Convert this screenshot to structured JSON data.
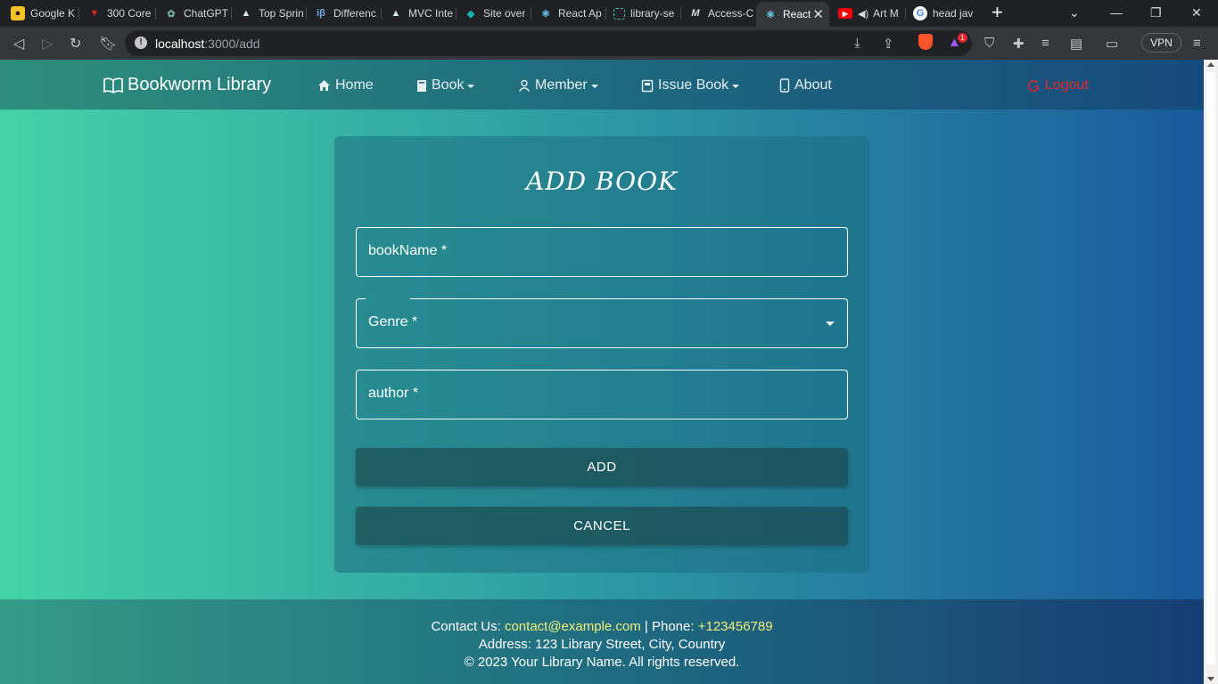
{
  "browser": {
    "tabs": [
      {
        "label": "Google K",
        "icon": "google-keep-icon",
        "color": "#f6c026"
      },
      {
        "label": "300 Core",
        "icon": "v-brand-icon",
        "color": "#d0251c"
      },
      {
        "label": "ChatGPT",
        "icon": "chatgpt-icon",
        "color": "#74aa9c"
      },
      {
        "label": "Top Sprin",
        "icon": "mountain-icon",
        "color": "#cfe6f5"
      },
      {
        "label": "Differenc",
        "icon": "ib-icon",
        "color": "#6fa8dc"
      },
      {
        "label": "MVC Inte",
        "icon": "mountain-icon",
        "color": "#cfe6f5"
      },
      {
        "label": "Site over",
        "icon": "diamond-icon",
        "color": "#13b5b1"
      },
      {
        "label": "React Ap",
        "icon": "react-icon",
        "color": "#61dafb"
      },
      {
        "label": "library-se",
        "icon": "code-icon",
        "color": "#3cc7c7"
      },
      {
        "label": "Access-C",
        "icon": "m-icon",
        "color": "#dddddd"
      },
      {
        "label": "React",
        "icon": "react-icon",
        "color": "#61dafb",
        "active": true
      },
      {
        "label": "Art M",
        "icon": "youtube-icon",
        "color": "#ff0000"
      },
      {
        "label": "head jav",
        "icon": "google-icon",
        "color": "#4285f4"
      }
    ],
    "url_host": "localhost",
    "url_path": ":3000/add",
    "vpn_label": "VPN",
    "notification_count": "1"
  },
  "navbar": {
    "brand": "Bookworm Library",
    "home": "Home",
    "book": "Book",
    "member": "Member",
    "issue_book": "Issue Book",
    "about": "About",
    "logout": "Logout"
  },
  "form": {
    "title": "ADD BOOK",
    "book_name_label": "bookName *",
    "genre_label": "Genre *",
    "author_label": "author *",
    "add_button": "ADD",
    "cancel_button": "CANCEL"
  },
  "footer": {
    "contact_prefix": "Contact Us: ",
    "email": "contact@example.com",
    "phone_sep": " | Phone: ",
    "phone": "+123456789",
    "address": "Address: 123 Library Street, City, Country",
    "copyright": "© 2023 Your Library Name. All rights reserved."
  },
  "colors": {
    "logout": "#e0282e",
    "footer_highlight": "#f1f07a",
    "gradient_start": "#45d3a6",
    "gradient_end": "#1a5a9c"
  }
}
